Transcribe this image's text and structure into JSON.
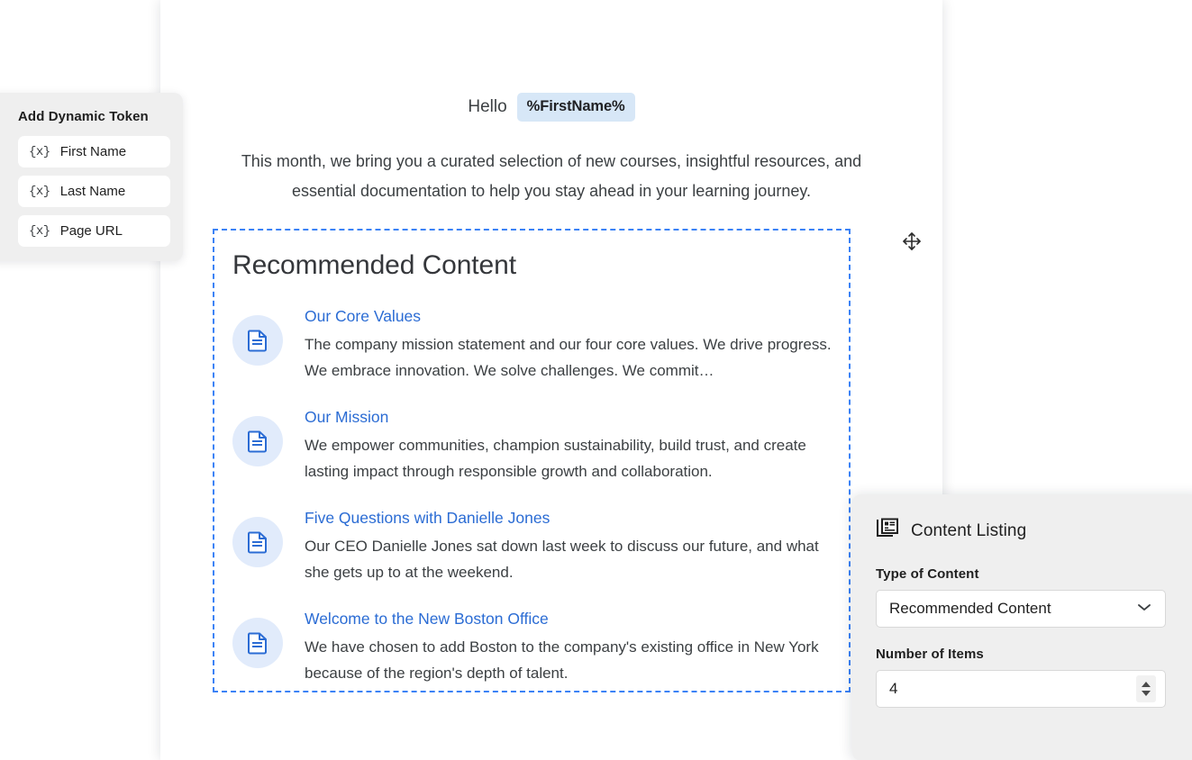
{
  "email": {
    "greeting_text": "Hello",
    "token_badge": "%FirstName%",
    "intro_paragraph": "This month, we bring you a curated selection of new courses, insightful resources, and essential documentation to help you stay ahead in your learning journey."
  },
  "content_block": {
    "title": "Recommended Content",
    "drag_handle_icon": "move-arrows-icon",
    "items": [
      {
        "icon": "document-icon",
        "title": "Our Core Values",
        "description": "The company mission statement and our four core values. We drive progress. We embrace innovation. We solve challenges. We commit…"
      },
      {
        "icon": "document-icon",
        "title": "Our Mission",
        "description": "We empower communities, champion sustainability, build trust, and create lasting impact through responsible growth and collaboration."
      },
      {
        "icon": "document-icon",
        "title": "Five Questions with Danielle Jones",
        "description": "Our CEO Danielle Jones sat down last week to discuss our future, and what she gets up to at the weekend."
      },
      {
        "icon": "document-icon",
        "title": "Welcome to the New Boston Office",
        "description": "We have chosen to add Boston to the company's existing office in New York because of the region's depth of talent."
      }
    ]
  },
  "token_panel": {
    "title": "Add Dynamic Token",
    "token_glyph": "{x}",
    "items": [
      {
        "label": "First Name"
      },
      {
        "label": "Last Name"
      },
      {
        "label": "Page URL"
      }
    ]
  },
  "settings_panel": {
    "icon": "content-listing-icon",
    "title": "Content Listing",
    "type_of_content": {
      "label": "Type of Content",
      "value": "Recommended Content",
      "chevron": "chevron-down-icon"
    },
    "number_of_items": {
      "label": "Number of Items",
      "value": "4"
    }
  },
  "colors": {
    "accent_blue": "#2b6cd4",
    "selection_border": "#3b82f6",
    "token_badge_bg": "#d7e7f7",
    "icon_circle_bg": "#e1ebfb",
    "panel_bg": "#efefef",
    "page_bg": "#ffffff"
  }
}
